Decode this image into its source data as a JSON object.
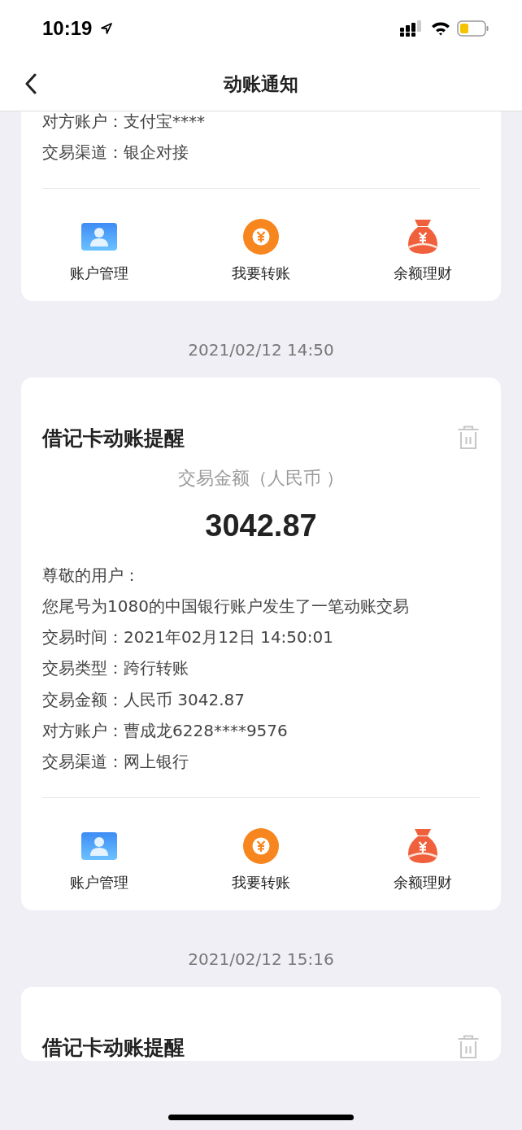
{
  "status_bar": {
    "time": "10:19"
  },
  "nav": {
    "title": "动账通知"
  },
  "cards": [
    {
      "lines": [
        "对方账户：支付宝****",
        "交易渠道：银企对接"
      ],
      "actions": [
        {
          "kind": "account",
          "label": "账户管理"
        },
        {
          "kind": "transfer",
          "label": "我要转账"
        },
        {
          "kind": "wealth",
          "label": "余额理财"
        }
      ]
    },
    {
      "date": "2021/02/12 14:50",
      "title": "借记卡动账提醒",
      "subtitle": "交易金额（人民币 ）",
      "amount": "3042.87",
      "lines": [
        "尊敬的用户：",
        "您尾号为1080的中国银行账户发生了一笔动账交易",
        "交易时间：2021年02月12日 14:50:01",
        "交易类型：跨行转账",
        "交易金额：人民币 3042.87",
        "对方账户：曹成龙6228****9576",
        "交易渠道：网上银行"
      ],
      "actions": [
        {
          "kind": "account",
          "label": "账户管理"
        },
        {
          "kind": "transfer",
          "label": "我要转账"
        },
        {
          "kind": "wealth",
          "label": "余额理财"
        }
      ]
    },
    {
      "date": "2021/02/12 15:16",
      "title": "借记卡动账提醒"
    }
  ]
}
